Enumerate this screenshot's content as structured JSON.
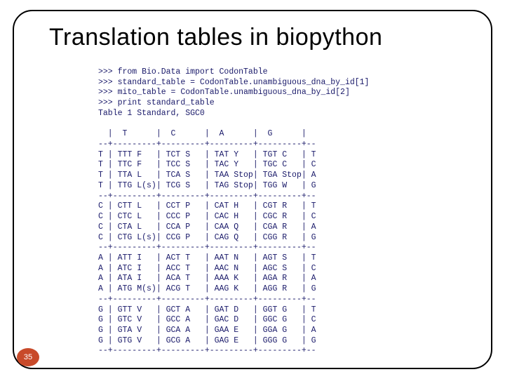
{
  "slide": {
    "title": "Translation tables in biopython",
    "page_number": "35"
  },
  "code_lines": [
    ">>> from Bio.Data import CodonTable",
    ">>> standard_table = CodonTable.unambiguous_dna_by_id[1]",
    ">>> mito_table = CodonTable.unambiguous_dna_by_id[2]",
    ">>> print standard_table",
    "Table 1 Standard, SGC0",
    "",
    "  |  T      |  C      |  A      |  G      |",
    "--+---------+---------+---------+---------+--",
    "T | TTT F   | TCT S   | TAT Y   | TGT C   | T",
    "T | TTC F   | TCC S   | TAC Y   | TGC C   | C",
    "T | TTA L   | TCA S   | TAA Stop| TGA Stop| A",
    "T | TTG L(s)| TCG S   | TAG Stop| TGG W   | G",
    "--+---------+---------+---------+---------+--",
    "C | CTT L   | CCT P   | CAT H   | CGT R   | T",
    "C | CTC L   | CCC P   | CAC H   | CGC R   | C",
    "C | CTA L   | CCA P   | CAA Q   | CGA R   | A",
    "C | CTG L(s)| CCG P   | CAG Q   | CGG R   | G",
    "--+---------+---------+---------+---------+--",
    "A | ATT I   | ACT T   | AAT N   | AGT S   | T",
    "A | ATC I   | ACC T   | AAC N   | AGC S   | C",
    "A | ATA I   | ACA T   | AAA K   | AGA R   | A",
    "A | ATG M(s)| ACG T   | AAG K   | AGG R   | G",
    "--+---------+---------+---------+---------+--",
    "G | GTT V   | GCT A   | GAT D   | GGT G   | T",
    "G | GTC V   | GCC A   | GAC D   | GGC G   | C",
    "G | GTA V   | GCA A   | GAA E   | GGA G   | A",
    "G | GTG V   | GCG A   | GAG E   | GGG G   | G",
    "--+---------+---------+---------+---------+--"
  ]
}
